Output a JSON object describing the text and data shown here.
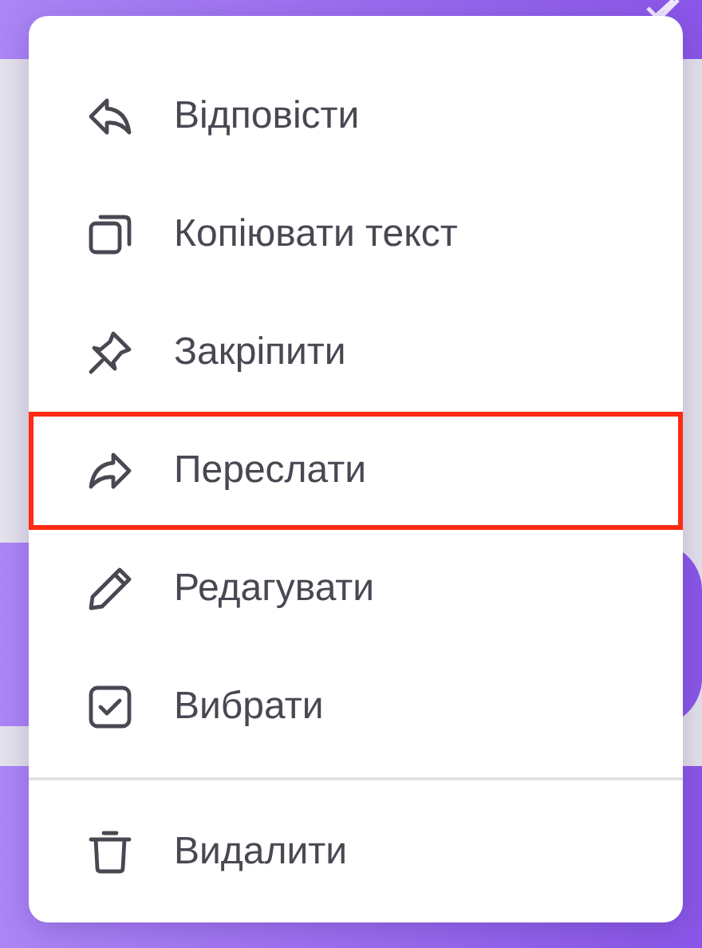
{
  "menu": {
    "items": [
      {
        "label": "Відповісти",
        "selected": false
      },
      {
        "label": "Копіювати текст",
        "selected": false
      },
      {
        "label": "Закріпити",
        "selected": false
      },
      {
        "label": "Переслати",
        "selected": true
      },
      {
        "label": "Редагувати",
        "selected": false
      },
      {
        "label": "Вибрати",
        "selected": false
      }
    ],
    "footer_items": [
      {
        "label": "Видалити",
        "selected": false
      }
    ]
  }
}
